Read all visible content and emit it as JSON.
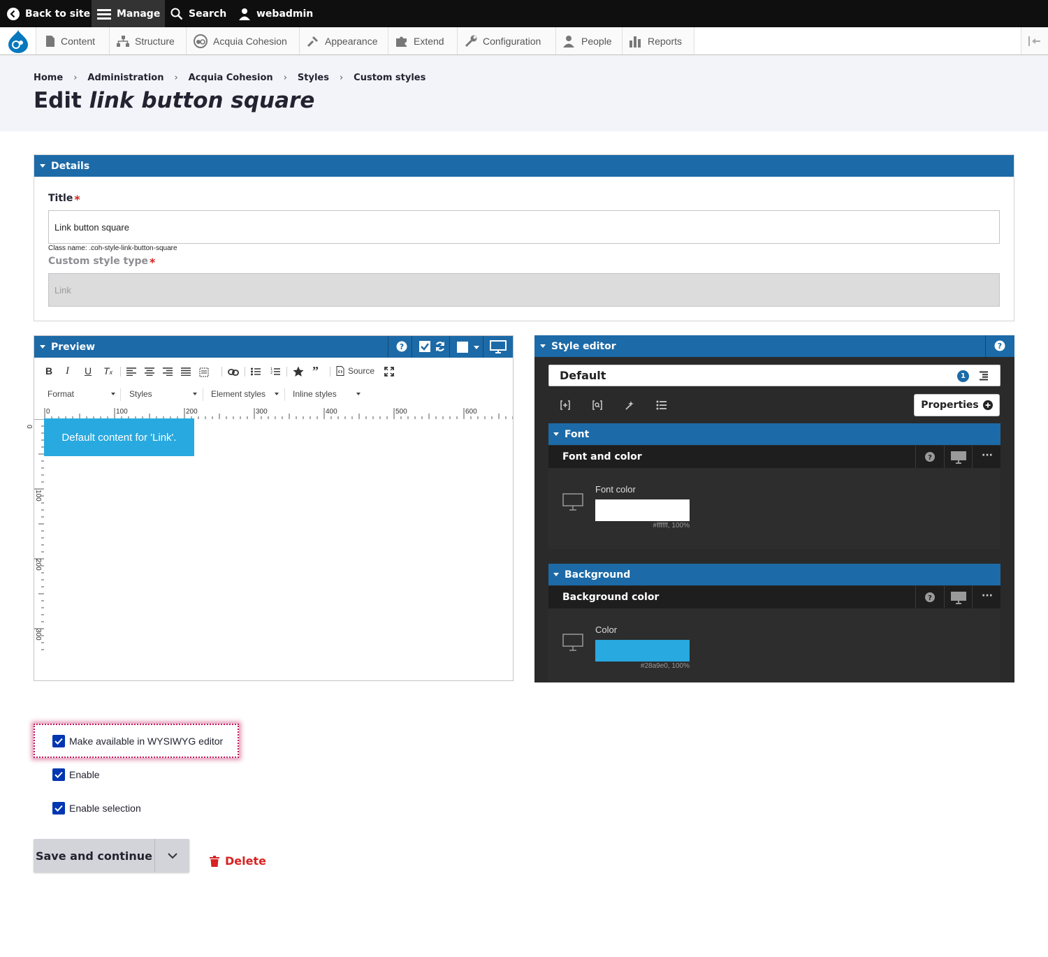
{
  "toolbar": {
    "back": "Back to site",
    "manage": "Manage",
    "search": "Search",
    "user": "webadmin"
  },
  "tray": {
    "items": [
      "Content",
      "Structure",
      "Acquia Cohesion",
      "Appearance",
      "Extend",
      "Configuration",
      "People",
      "Reports"
    ]
  },
  "breadcrumb": [
    "Home",
    "Administration",
    "Acquia Cohesion",
    "Styles",
    "Custom styles"
  ],
  "title": {
    "prefix": "Edit",
    "name": "link button square"
  },
  "details": {
    "heading": "Details",
    "title_label": "Title",
    "title_value": "Link button square",
    "class_name": "Class name: .coh-style-link-button-square",
    "type_label": "Custom style type",
    "type_value": "Link"
  },
  "preview": {
    "heading": "Preview",
    "source_label": "Source",
    "dropdowns": [
      "Format",
      "Styles",
      "Element styles",
      "Inline styles"
    ],
    "ruler_h": [
      "0",
      "100",
      "200",
      "300",
      "400",
      "500",
      "600"
    ],
    "ruler_v": [
      "0",
      "100",
      "200",
      "300"
    ],
    "content": "Default content for 'Link'.",
    "content_bg": "#28a9e0"
  },
  "style_editor": {
    "heading": "Style editor",
    "selector": "Default",
    "badge": "1",
    "properties_label": "Properties",
    "font_section": "Font",
    "font_sub": "Font and color",
    "font_color_label": "Font color",
    "font_color_value": "#ffffff, 100%",
    "font_color_hex": "#ffffff",
    "bg_section": "Background",
    "bg_sub": "Background color",
    "bg_color_label": "Color",
    "bg_color_value": "#28a9e0, 100%",
    "bg_color_hex": "#28a9e0"
  },
  "options": {
    "wysiwyg": "Make available in WYSIWYG editor",
    "enable": "Enable",
    "enable_selection": "Enable selection"
  },
  "actions": {
    "save": "Save and continue",
    "delete": "Delete"
  },
  "colors": {
    "brand_blue": "#1c6aa7",
    "checkbox_blue": "#0036b1",
    "danger": "#d72222"
  }
}
